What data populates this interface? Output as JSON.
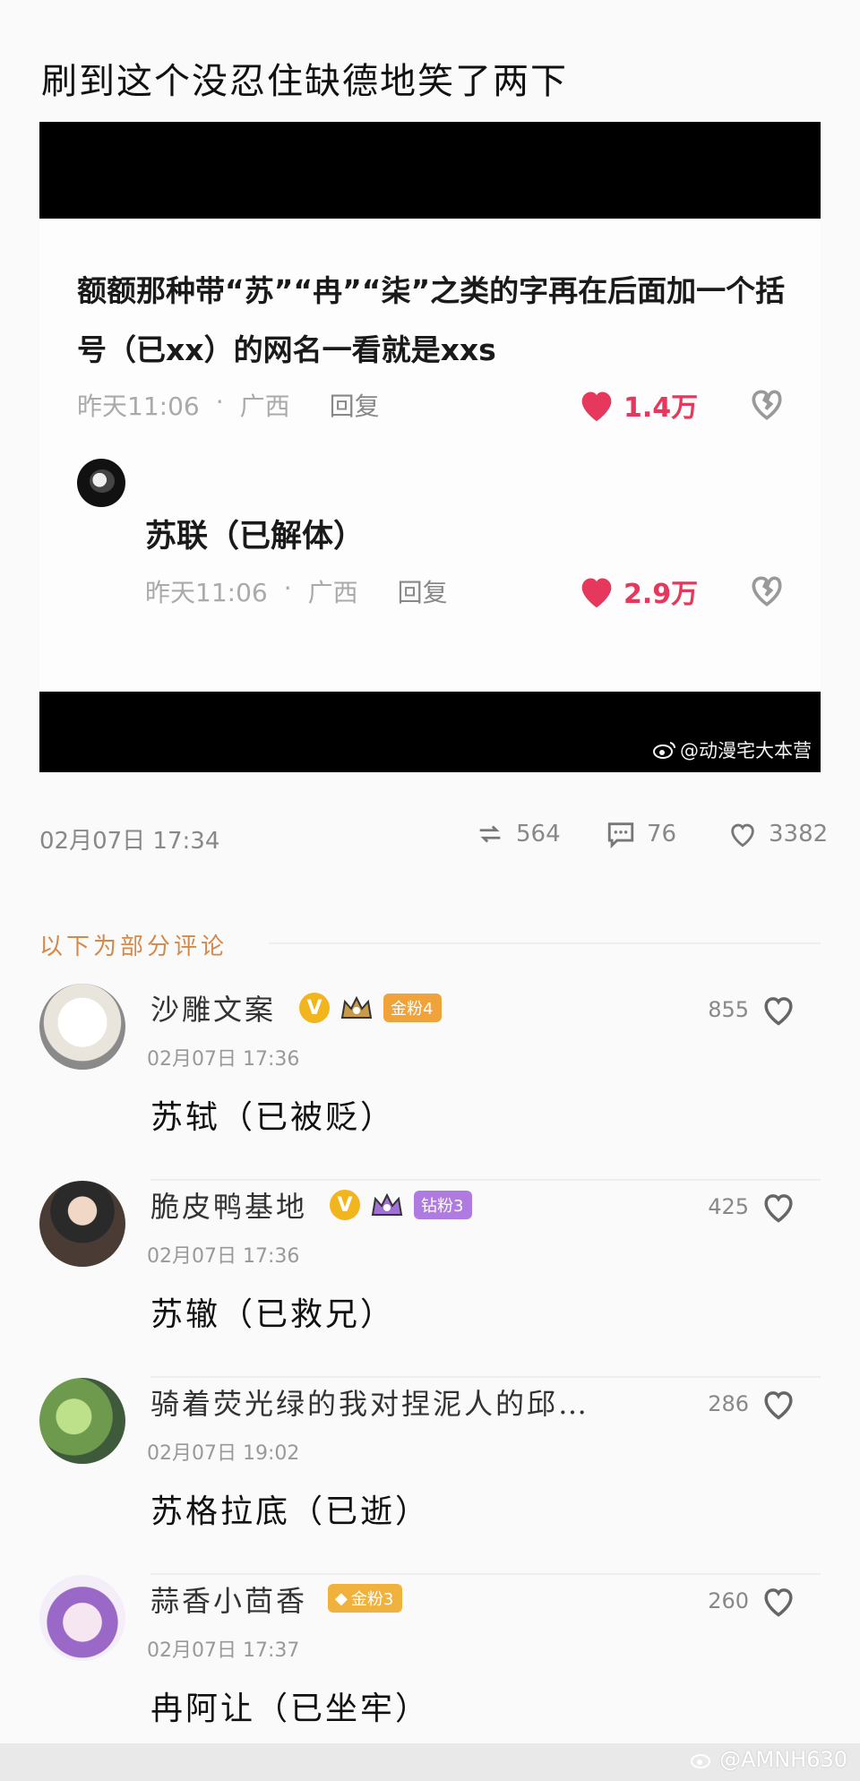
{
  "post": {
    "title": "刷到这个没忍住缺德地笑了两下",
    "date": "02月07日  17:34",
    "reposts": "564",
    "comments": "76",
    "likes": "3382"
  },
  "embedded": {
    "comment_text": "额额那种带“苏”“冉”“柒”之类的字再在后面加一个括号（已xx）的网名一看就是xxs",
    "comment_time": "昨天11:06",
    "comment_location": "广西",
    "reply_label": "回复",
    "comment_likes": "1.4万",
    "reply_name": "苏联（已解体）",
    "reply_time": "昨天11:06",
    "reply_location": "广西",
    "reply_likes": "2.9万",
    "watermark": "@动漫宅大本营"
  },
  "section_label": "以下为部分评论",
  "comments": [
    {
      "name": "沙雕文案",
      "badge": "金粉4",
      "badge_color": "#f0a33a",
      "crown_color": "#c79a4c",
      "date": "02月07日  17:36",
      "text": "苏轼（已被贬）",
      "likes": "855",
      "verified": true
    },
    {
      "name": "脆皮鸭基地",
      "badge": "钻粉3",
      "badge_color": "#b07be0",
      "crown_color": "#a070d6",
      "date": "02月07日  17:36",
      "text": "苏辙（已救兄）",
      "likes": "425",
      "verified": true
    },
    {
      "name": "骑着荧光绿的我对捏泥人的邱…",
      "badge": "",
      "badge_color": "",
      "crown_color": "",
      "date": "02月07日  19:02",
      "text": "苏格拉底（已逝）",
      "likes": "286",
      "verified": false
    },
    {
      "name": "蒜香小茴香",
      "badge": "金粉3",
      "badge_color": "#f0b23d",
      "crown_color": "",
      "date": "02月07日  17:37",
      "text": "冉阿让（已坐牢）",
      "likes": "260",
      "verified": false
    }
  ],
  "bottom_watermark": "@AMNH630",
  "colors": {
    "like_red": "#e6375d",
    "section_orange": "#d4894a",
    "verified_gold": "#f3b51e"
  }
}
